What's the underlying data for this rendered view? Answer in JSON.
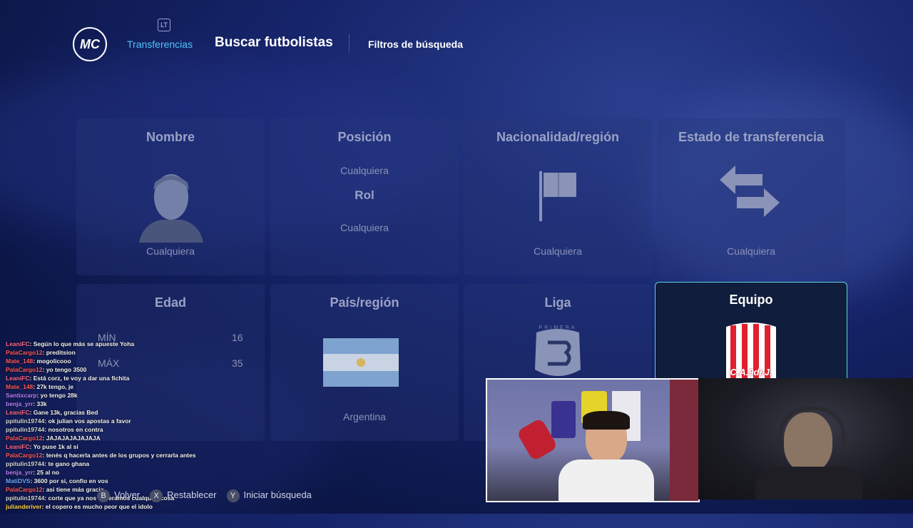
{
  "header": {
    "logo_text": "MC",
    "lt_badge": "LT",
    "breadcrumb": "Transferencias",
    "title": "Buscar futbolistas",
    "filters_link": "Filtros de búsqueda"
  },
  "cards": {
    "nombre": {
      "label": "Nombre",
      "value": "Cualquiera"
    },
    "posicion": {
      "label": "Posición",
      "value_top": "Cualquiera",
      "sub_label": "Rol",
      "value_bottom": "Cualquiera"
    },
    "nacionalidad": {
      "label": "Nacionalidad/región",
      "value": "Cualquiera"
    },
    "estado": {
      "label": "Estado de transferencia",
      "value": "Cualquiera"
    },
    "edad": {
      "label": "Edad",
      "min_label": "MÍN",
      "min_value": "16",
      "max_label": "MÁX",
      "max_value": "35"
    },
    "pais": {
      "label": "País/región",
      "value": "Argentina"
    },
    "liga": {
      "label": "Liga",
      "logo_text": "PRIMERA"
    },
    "equipo": {
      "label": "Equipo",
      "crest_text": "C.A.9deJ."
    }
  },
  "footer": {
    "back": "Volver",
    "reset": "Restablecer",
    "search": "Iniciar búsqueda",
    "back_key": "B",
    "reset_key": "X",
    "search_key": "Y"
  },
  "chat": [
    {
      "user": "LeaniFC",
      "color": "#ff6b8a",
      "text": ": Según lo que más se apueste Yoha"
    },
    {
      "user": "PalaCargo12",
      "color": "#ff5a5a",
      "text": ": preditsion"
    },
    {
      "user": "Mate_148",
      "color": "#ff5a5a",
      "text": ": mogolicooo"
    },
    {
      "user": "PalaCargo12",
      "color": "#ff5a5a",
      "text": ": yo tengo 3500"
    },
    {
      "user": "LeaniFC",
      "color": "#ff6b8a",
      "text": ": Está corz, te voy a dar una fichita"
    },
    {
      "user": "Mate_148",
      "color": "#ff5a5a",
      "text": ": 27k tengo, je"
    },
    {
      "user": "Santixcarp",
      "color": "#c080ff",
      "text": ": yo tengo 28k"
    },
    {
      "user": "benja_yrr",
      "color": "#c080ff",
      "text": ": 33k"
    },
    {
      "user": "LeaniFC",
      "color": "#ff6b8a",
      "text": ": Gane 13k, gracias Bed"
    },
    {
      "user": "ppitulin19744",
      "color": "#d8d8d8",
      "text": ": ok julian vos apostas a favor"
    },
    {
      "user": "ppitulin19744",
      "color": "#d8d8d8",
      "text": ": nosotros en contra"
    },
    {
      "user": "PalaCargo12",
      "color": "#ff5a5a",
      "text": ": JAJAJAJAJAJAJA"
    },
    {
      "user": "LeaniFC",
      "color": "#ff6b8a",
      "text": ": Yo puse 1k al si"
    },
    {
      "user": "PalaCargo12",
      "color": "#ff5a5a",
      "text": ": tenés q hacerla antes de los grupos y cerrarla antes"
    },
    {
      "user": "ppitulin19744",
      "color": "#d8d8d8",
      "text": ": te gano ghana"
    },
    {
      "user": "benja_yrr",
      "color": "#c080ff",
      "text": ": 25 al no"
    },
    {
      "user": "MatiDVS",
      "color": "#6fa8ff",
      "text": ": 3600 por si, confio en vos"
    },
    {
      "user": "PalaCargo12",
      "color": "#ff5a5a",
      "text": ": asi tiene más gracia"
    },
    {
      "user": "ppitulin19744",
      "color": "#d8d8d8",
      "text": ": corte que ya nos esperamos cualquier cosa"
    },
    {
      "user": "julianderiver",
      "color": "#ffd24a",
      "text": ": el copero es mucho peor que el idolo"
    }
  ]
}
